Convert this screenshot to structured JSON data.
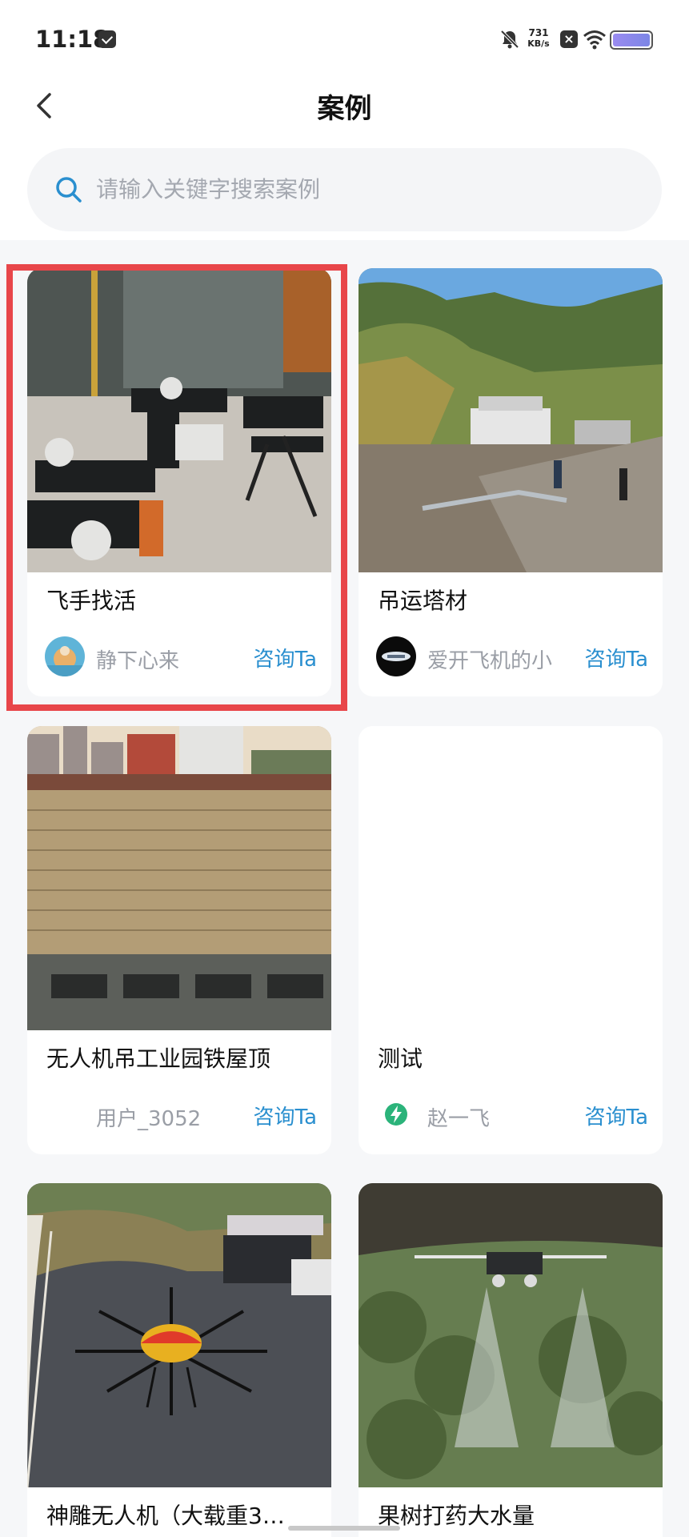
{
  "status_bar": {
    "time": "11:18",
    "speed_value": "731",
    "speed_unit": "KB/s",
    "battery_color": "#8e88ee"
  },
  "header": {
    "title": "案例",
    "back_icon": "chevron-left-icon"
  },
  "search": {
    "placeholder": "请输入关键字搜索案例",
    "icon": "search-icon",
    "icon_color": "#2a8fcf"
  },
  "cards": [
    {
      "title": "飞手找活",
      "user": "静下心来",
      "consult": "咨询Ta",
      "image": "drones-in-warehouse",
      "selected": true
    },
    {
      "title": "吊运塔材",
      "user": "爱开飞机的小",
      "consult": "咨询Ta",
      "image": "mountain-village"
    },
    {
      "title": "无人机吊工业园铁屋顶",
      "user": "用户_3052",
      "consult": "咨询Ta",
      "image": "industrial-roof"
    },
    {
      "title": "测试",
      "user": "赵一飞",
      "consult": "咨询Ta",
      "image": "blank"
    },
    {
      "title": "神雕无人机（大载重3…",
      "user": "",
      "consult": "",
      "image": "large-drone-on-road"
    },
    {
      "title": "果树打药大水量",
      "user": "",
      "consult": "",
      "image": "spraying-drone-orchard"
    }
  ],
  "colors": {
    "accent": "#2a8fcf",
    "highlight": "#e8464a",
    "page_bg": "#f6f7f9"
  }
}
